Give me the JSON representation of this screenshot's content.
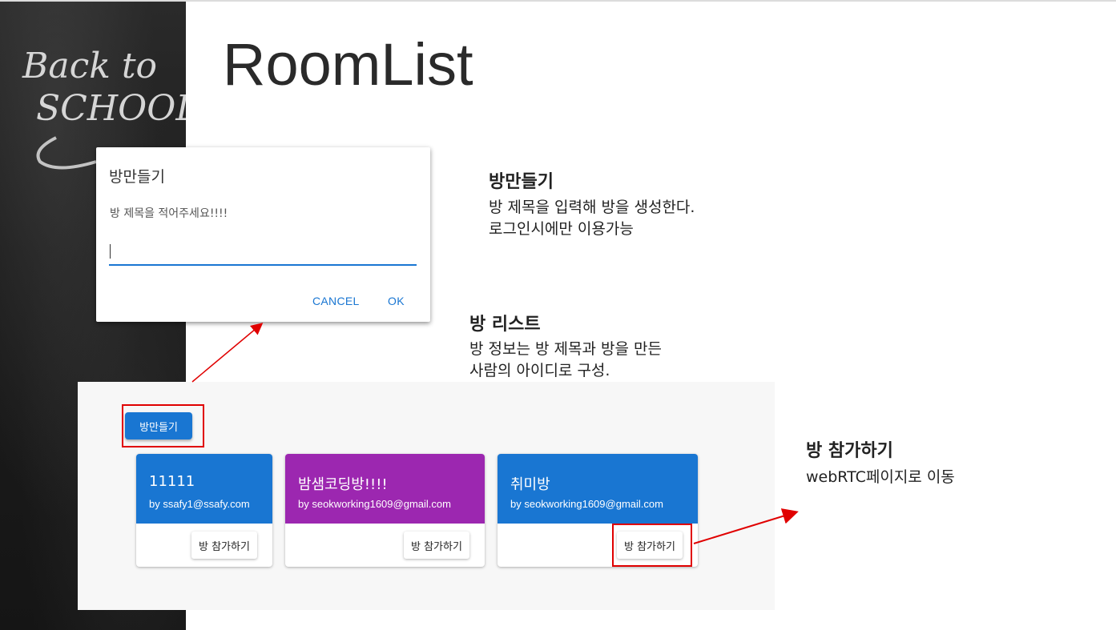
{
  "page": {
    "title": "RoomList"
  },
  "chalkboard": {
    "text_line1": "Back to",
    "text_line2": "SCHOOL"
  },
  "dialog": {
    "title": "방만들기",
    "prompt": "방 제목을 적어주세요!!!!",
    "input_value": "",
    "cancel_label": "CANCEL",
    "ok_label": "OK"
  },
  "annotations": {
    "create": {
      "heading": "방만들기",
      "line1": "방 제목을 입력해 방을 생성한다.",
      "line2": "로그인시에만 이용가능"
    },
    "list": {
      "heading": "방 리스트",
      "line1": "방 정보는 방 제목과 방을 만든",
      "line2": "사람의 아이디로 구성."
    },
    "join": {
      "heading": "방 참가하기",
      "line1": "webRTC페이지로 이동"
    }
  },
  "roomlist": {
    "create_button_label": "방만들기",
    "rooms": [
      {
        "title": "11111",
        "by": "by ssafy1@ssafy.com",
        "join_label": "방 참가하기",
        "color": "#1976d2"
      },
      {
        "title": "밤샘코딩방!!!!",
        "by": "by seokworking1609@gmail.com",
        "join_label": "방 참가하기",
        "color": "#9c27b0"
      },
      {
        "title": "취미방",
        "by": "by seokworking1609@gmail.com",
        "join_label": "방 참가하기",
        "color": "#1976d2"
      }
    ]
  },
  "colors": {
    "primary": "#1976d2",
    "secondary": "#9c27b0",
    "highlight": "#e00000"
  }
}
